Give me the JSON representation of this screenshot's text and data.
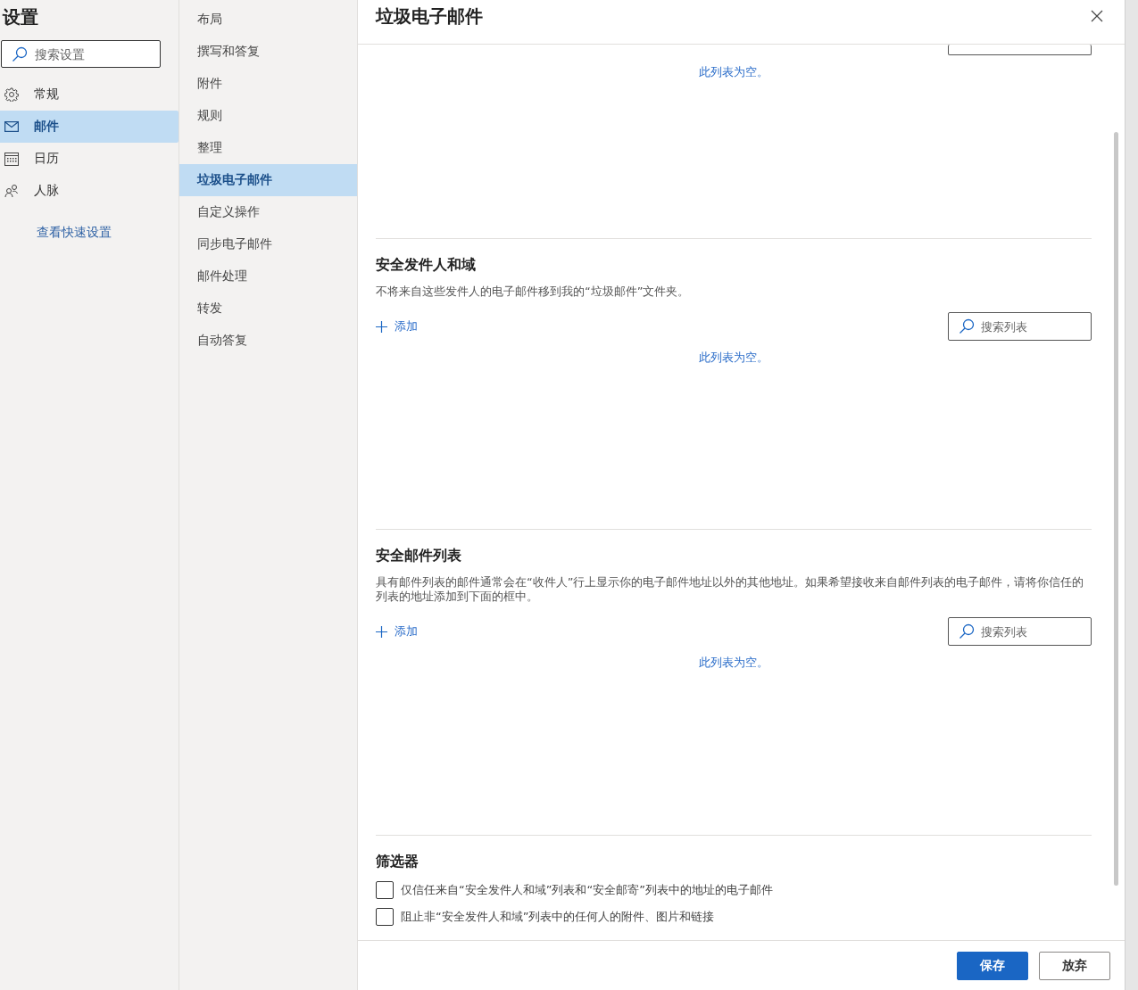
{
  "title": "设置",
  "search": {
    "placeholder": "搜索设置"
  },
  "nav": [
    {
      "label": "常规",
      "kind": "gear",
      "selected": false
    },
    {
      "label": "邮件",
      "kind": "mail",
      "selected": true
    },
    {
      "label": "日历",
      "kind": "calendar",
      "selected": false
    },
    {
      "label": "人脉",
      "kind": "people",
      "selected": false
    }
  ],
  "quick_link": "查看快速设置",
  "subnav": [
    {
      "label": "布局",
      "selected": false
    },
    {
      "label": "撰写和答复",
      "selected": false
    },
    {
      "label": "附件",
      "selected": false
    },
    {
      "label": "规则",
      "selected": false
    },
    {
      "label": "整理",
      "selected": false
    },
    {
      "label": "垃圾电子邮件",
      "selected": true
    },
    {
      "label": "自定义操作",
      "selected": false
    },
    {
      "label": "同步电子邮件",
      "selected": false
    },
    {
      "label": "邮件处理",
      "selected": false
    },
    {
      "label": "转发",
      "selected": false
    },
    {
      "label": "自动答复",
      "selected": false
    }
  ],
  "panel": {
    "title": "垃圾电子邮件",
    "sections": [
      {
        "kind": "clipped",
        "empty_text": "此列表为空。"
      },
      {
        "kind": "list",
        "title": "安全发件人和域",
        "description": "不将来自这些发件人的电子邮件移到我的“垃圾邮件”文件夹。",
        "add_label": "添加",
        "search_placeholder": "搜索列表",
        "empty_text": "此列表为空。"
      },
      {
        "kind": "list",
        "title": "安全邮件列表",
        "description": "具有邮件列表的邮件通常会在“收件人”行上显示你的电子邮件地址以外的其他地址。如果希望接收来自邮件列表的电子邮件，请将你信任的列表的地址添加到下面的框中。",
        "add_label": "添加",
        "search_placeholder": "搜索列表",
        "empty_text": "此列表为空。"
      }
    ],
    "filters": {
      "title": "筛选器",
      "options": [
        {
          "label": "仅信任来自“安全发件人和域”列表和“安全邮寄”列表中的地址的电子邮件",
          "checked": false
        },
        {
          "label": "阻止非“安全发件人和域”列表中的任何人的附件、图片和链接",
          "checked": false
        }
      ]
    },
    "buttons": [
      {
        "label": "保存",
        "kind": "primary"
      },
      {
        "label": "放弃",
        "kind": "secondary"
      }
    ]
  }
}
